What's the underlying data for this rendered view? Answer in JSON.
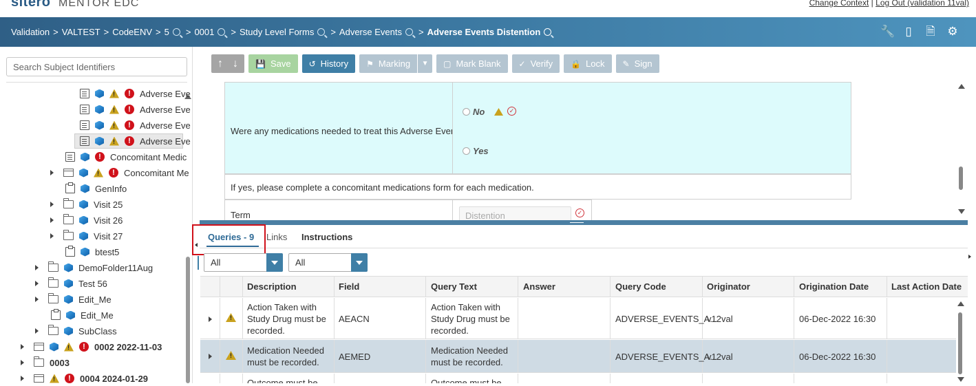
{
  "app": {
    "brand": "sitero",
    "product": "MENTOR EDC"
  },
  "top_links": {
    "change_context": "Change Context",
    "separator": "|",
    "logout": "Log Out (validation 11val)"
  },
  "breadcrumb": {
    "items": [
      "Validation",
      "VALTEST",
      "CodeENV",
      "5",
      "0001",
      "Study Level Forms",
      "Adverse Events",
      "Adverse Events Distention"
    ],
    "separator": ">"
  },
  "header_icons": [
    "wrench-icon",
    "tablet-icon",
    "document-icon",
    "gear-icon"
  ],
  "search": {
    "placeholder": "Search Subject Identifiers",
    "value": ""
  },
  "tree": {
    "nodes": [
      {
        "label": "Adverse Eve",
        "icons": [
          "form",
          "cube",
          "warn",
          "err"
        ]
      },
      {
        "label": "Adverse Eve",
        "icons": [
          "form",
          "cube",
          "warn",
          "err"
        ]
      },
      {
        "label": "Adverse Eve",
        "icons": [
          "form",
          "cube",
          "warn",
          "err"
        ]
      },
      {
        "label": "Adverse Eve",
        "icons": [
          "form",
          "cube",
          "warn",
          "err"
        ],
        "selected": true
      },
      {
        "label": "Concomitant Medic",
        "icons": [
          "form",
          "cube",
          "err"
        ]
      },
      {
        "label": "Concomitant Me",
        "icons": [
          "foldform",
          "cube",
          "warn",
          "err"
        ],
        "expandable": true
      },
      {
        "label": "GenInfo",
        "icons": [
          "clip",
          "cube"
        ]
      },
      {
        "label": "Visit 25",
        "icons": [
          "folder",
          "cube"
        ],
        "expandable": true
      },
      {
        "label": "Visit 26",
        "icons": [
          "folder",
          "cube"
        ],
        "expandable": true
      },
      {
        "label": "Visit 27",
        "icons": [
          "folder",
          "cube"
        ],
        "expandable": true
      },
      {
        "label": "btest5",
        "icons": [
          "clip",
          "cube"
        ]
      },
      {
        "label": "DemoFolder11Aug",
        "icons": [
          "folder",
          "cube"
        ],
        "expandable": true
      },
      {
        "label": "Test 56",
        "icons": [
          "folder",
          "cube"
        ],
        "expandable": true
      },
      {
        "label": "Edit_Me",
        "icons": [
          "folder",
          "cube"
        ],
        "expandable": true
      },
      {
        "label": "Edit_Me",
        "icons": [
          "clip",
          "cube"
        ]
      },
      {
        "label": "SubClass",
        "icons": [
          "folder",
          "cube"
        ],
        "expandable": true
      },
      {
        "label": "0002 2022-11-03",
        "icons": [
          "foldform",
          "cube",
          "warn",
          "err"
        ],
        "expandable": true,
        "bold": true
      },
      {
        "label": "0003",
        "icons": [
          "folder"
        ],
        "expandable": true,
        "bold": true
      },
      {
        "label": "0004 2024-01-29",
        "icons": [
          "foldform",
          "warn",
          "err"
        ],
        "expandable": true,
        "bold": true
      }
    ]
  },
  "toolbar": {
    "save": "Save",
    "history": "History",
    "marking": "Marking",
    "mark_blank": "Mark Blank",
    "verify": "Verify",
    "lock": "Lock",
    "sign": "Sign"
  },
  "form": {
    "question": "Were any medications needed to treat this Adverse Event?",
    "options": [
      "No",
      "Yes"
    ],
    "instruction": "If yes, please complete a concomitant medications form for each medication.",
    "term_label": "Term",
    "term_value": "Distention"
  },
  "query_tabs": {
    "queries": "Queries - 9",
    "links": "Links",
    "instructions": "Instructions"
  },
  "filters": {
    "first": "All",
    "second": "All"
  },
  "grid": {
    "columns": [
      "Description",
      "Field",
      "Query Text",
      "Answer",
      "Query Code",
      "Originator",
      "Origination Date",
      "Last Action Date"
    ],
    "rows": [
      {
        "description": "Action Taken with Study Drug must be recorded.",
        "field": "AEACN",
        "query_text": "Action Taken with Study Drug must be recorded.",
        "answer": "",
        "query_code": "ADVERSE_EVENTS_A...",
        "originator": "v12val",
        "origination_date": "06-Dec-2022 16:30",
        "last_action_date": ""
      },
      {
        "description": "Medication Needed must be recorded.",
        "field": "AEMED",
        "query_text": "Medication Needed must be recorded.",
        "answer": "",
        "query_code": "ADVERSE_EVENTS_A...",
        "originator": "v12val",
        "origination_date": "06-Dec-2022 16:30",
        "last_action_date": "",
        "selected": true
      },
      {
        "description": "Outcome must be",
        "field": "",
        "query_text": "Outcome must be",
        "answer": "",
        "query_code": "",
        "originator": "",
        "origination_date": "",
        "last_action_date": ""
      }
    ]
  }
}
